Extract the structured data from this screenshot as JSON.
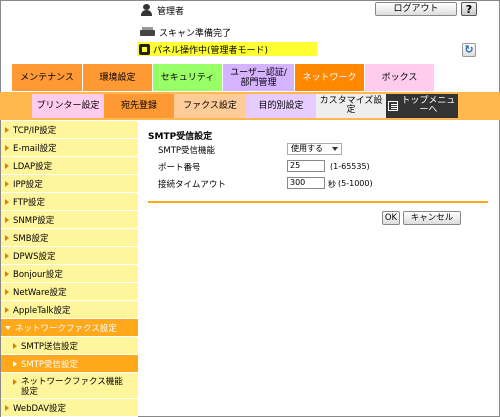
{
  "header": {
    "user_label": "管理者",
    "logout_label": "ログアウト",
    "help_label": "?",
    "status_scan": "スキャン準備完了",
    "status_panel": "パネル操作中(管理者モード)",
    "refresh_glyph": "↻"
  },
  "tabs_row1": [
    {
      "label": "メンテナンス",
      "color": "#ff9933"
    },
    {
      "label": "環境設定",
      "color": "#ff9933"
    },
    {
      "label": "セキュリティ",
      "color": "#99ff66"
    },
    {
      "label": "ユーザー認証/部門管理",
      "color": "#d6b3ff"
    },
    {
      "label": "ネットワーク",
      "color": "#ff8800"
    },
    {
      "label": "ボックス",
      "color": "#ffccee"
    }
  ],
  "tabs_row2": [
    {
      "label": "プリンター設定",
      "color": "#ffccee"
    },
    {
      "label": "宛先登録",
      "color": "#ff9933"
    },
    {
      "label": "ファクス設定",
      "color": "#ffcc99"
    },
    {
      "label": "目的別設定",
      "color": "#e6ccff"
    },
    {
      "label": "カスタマイズ設定",
      "color": "#eeeeee"
    },
    {
      "label": "トップメニューへ",
      "color": "#333333"
    }
  ],
  "sidebar": {
    "items": [
      "TCP/IP設定",
      "E-mail設定",
      "LDAP設定",
      "IPP設定",
      "FTP設定",
      "SNMP設定",
      "SMB設定",
      "DPWS設定",
      "Bonjour設定",
      "NetWare設定",
      "AppleTalk設定",
      "ネットワークファクス設定",
      "SMTP送信設定",
      "SMTP受信設定",
      "ネットワークファクス機能設定",
      "WebDAV設定"
    ]
  },
  "form": {
    "title": "SMTP受信設定",
    "fields": [
      {
        "label": "SMTP受信機能",
        "value": "使用する"
      },
      {
        "label": "ポート番号",
        "value": "25",
        "hint": "(1-65535)"
      },
      {
        "label": "接続タイムアウト",
        "value": "300",
        "unit": "秒",
        "hint": "(5-1000)"
      }
    ],
    "ok_label": "OK",
    "cancel_label": "キャンセル"
  },
  "colors": {
    "accent": "#ffa81a",
    "sidebar_bg": "#fff59d",
    "status_highlight": "#ffff33"
  }
}
